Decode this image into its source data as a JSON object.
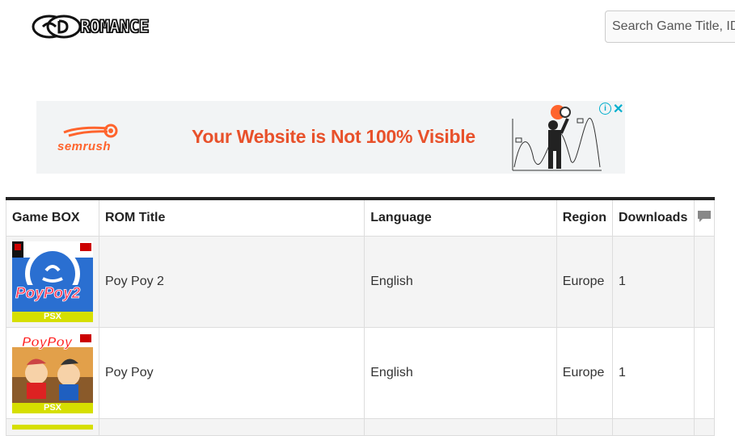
{
  "header": {
    "logo_text": "ROMANCE",
    "logo_mark": "CD",
    "search_placeholder": "Search Game Title, ID"
  },
  "ad": {
    "brand": "semrush",
    "headline": "Your Website is Not 100% Visible",
    "info_icon": "info-icon",
    "close_icon": "close-icon",
    "accent_color": "#e8512b"
  },
  "table": {
    "headers": [
      "Game BOX",
      "ROM Title",
      "Language",
      "Region",
      "Downloads"
    ],
    "comment_icon": "comment-icon",
    "rows": [
      {
        "cover_title": "PoyPoy2",
        "platform": "PSX",
        "title": "Poy Poy 2",
        "language": "English",
        "region": "Europe",
        "downloads": "1"
      },
      {
        "cover_title": "PoyPoy",
        "platform": "PSX",
        "title": "Poy Poy",
        "language": "English",
        "region": "Europe",
        "downloads": "1"
      }
    ]
  }
}
